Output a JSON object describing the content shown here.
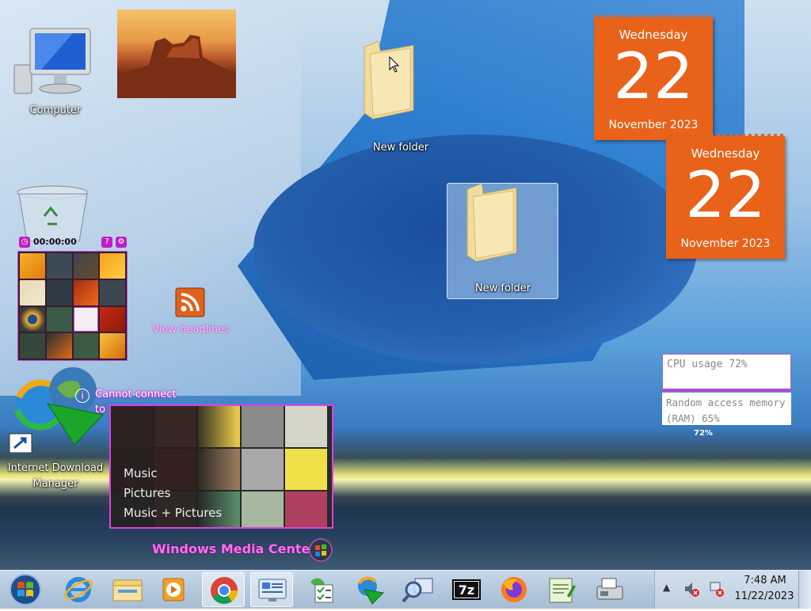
{
  "desktop": {
    "computer_label": "Computer",
    "folder_1_label": "New folder",
    "folder_2_label": "New folder",
    "rss_label": "View headlines",
    "idm_label_1": "Internet Download",
    "idm_label_2": "Manager"
  },
  "calendars": [
    {
      "day": "Wednesday",
      "date": "22",
      "month": "November 2023"
    },
    {
      "day": "Wednesday",
      "date": "22",
      "month": "November 2023"
    }
  ],
  "puzzle": {
    "timer": "00:00:00",
    "help_icon": "?",
    "options_icon": "gear",
    "accent_color": "#c01fc2"
  },
  "media_center": {
    "message_line_1": "Cannot connect",
    "message_line_2": "to service",
    "items": [
      "Music",
      "Pictures",
      "Music + Pictures"
    ],
    "title": "Windows Media Center"
  },
  "cpu_meter": {
    "cpu_label": "CPU usage 72%",
    "ram_label": "Random access memory (RAM) 65%",
    "cpu_percent": 72,
    "ram_percent": 65,
    "cpu_small": "72%"
  },
  "taskbar": {
    "apps": [
      "internet-explorer",
      "file-explorer",
      "media-player",
      "chrome",
      "remote-desktop",
      "checklist",
      "internet-download-manager",
      "magnifier",
      "7-zip",
      "firefox",
      "notepad",
      "fax-scanner"
    ],
    "active_app": "chrome",
    "tray_arrow": "▲",
    "time": "7:48 AM",
    "date": "11/22/2023"
  }
}
